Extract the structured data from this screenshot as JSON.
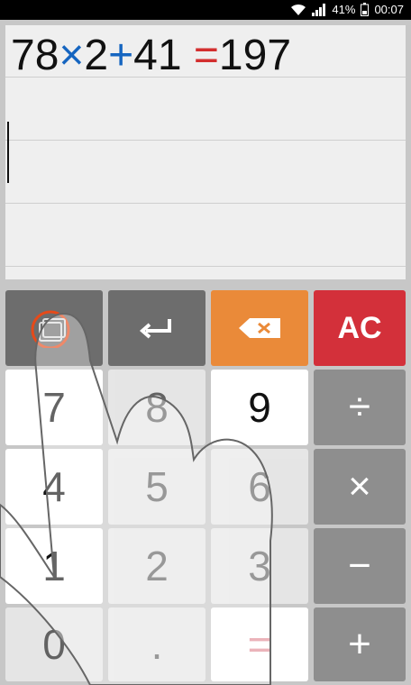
{
  "status_bar": {
    "battery": "41%",
    "time": "00:07",
    "icons": [
      "wifi-icon",
      "signal-icon",
      "battery-icon"
    ]
  },
  "display": {
    "expression": {
      "a": "78",
      "op1": "×",
      "b": "2",
      "op2": "+",
      "c": "41",
      "eq": "=",
      "result": "197"
    }
  },
  "keypad": {
    "history_label": "",
    "enter_label": "",
    "backspace_label": "",
    "clear_label": "AC",
    "digits": [
      "7",
      "8",
      "9",
      "4",
      "5",
      "6",
      "1",
      "2",
      "3",
      "0",
      "."
    ],
    "ops": {
      "divide": "÷",
      "multiply": "×",
      "minus": "−",
      "plus": "+",
      "equals": "="
    }
  },
  "colors": {
    "accent_orange": "#ea8a39",
    "accent_red": "#d3303a",
    "operator_blue": "#1565c0"
  }
}
